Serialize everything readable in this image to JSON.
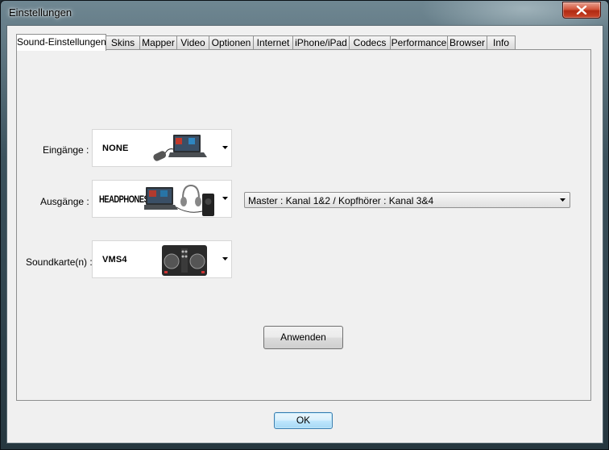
{
  "window": {
    "title": "Einstellungen",
    "close_icon": "close-x-icon"
  },
  "tabs": [
    {
      "label": "Sound-Einstellungen",
      "active": true
    },
    {
      "label": "Skins"
    },
    {
      "label": "Mapper"
    },
    {
      "label": "Video"
    },
    {
      "label": "Optionen"
    },
    {
      "label": "Internet"
    },
    {
      "label": "iPhone/iPad"
    },
    {
      "label": "Codecs"
    },
    {
      "label": "Performance"
    },
    {
      "label": "Browser"
    },
    {
      "label": "Info"
    }
  ],
  "sound": {
    "inputs": {
      "label": "Eingänge :",
      "value": "NONE",
      "icon": "laptop-mixer-icon"
    },
    "outputs": {
      "label": "Ausgänge :",
      "value": "HEADPHONES",
      "icon": "laptop-headphones-speaker-icon"
    },
    "soundcard": {
      "label": "Soundkarte(n) :",
      "value": "VMS4",
      "icon": "dj-controller-icon"
    },
    "routing": {
      "value": "Master : Kanal 1&2 / Kopfhörer : Kanal 3&4"
    },
    "apply_label": "Anwenden"
  },
  "footer": {
    "ok_label": "OK"
  }
}
